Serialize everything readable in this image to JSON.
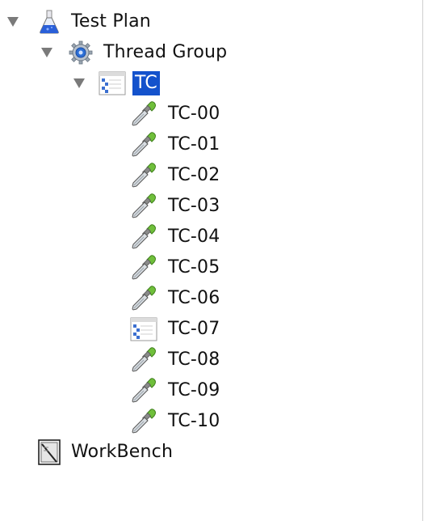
{
  "tree": {
    "test_plan": {
      "label": "Test Plan",
      "icon": "flask-icon",
      "expanded": true
    },
    "thread_group": {
      "label": "Thread Group",
      "icon": "gear-icon",
      "expanded": true
    },
    "controller": {
      "label": "TC",
      "icon": "module-controller-icon",
      "expanded": true,
      "selected": true
    },
    "children": [
      {
        "label": "TC-00",
        "icon": "sampler-pipette-icon"
      },
      {
        "label": "TC-01",
        "icon": "sampler-pipette-icon"
      },
      {
        "label": "TC-02",
        "icon": "sampler-pipette-icon"
      },
      {
        "label": "TC-03",
        "icon": "sampler-pipette-icon"
      },
      {
        "label": "TC-04",
        "icon": "sampler-pipette-icon"
      },
      {
        "label": "TC-05",
        "icon": "sampler-pipette-icon"
      },
      {
        "label": "TC-06",
        "icon": "sampler-pipette-icon"
      },
      {
        "label": "TC-07",
        "icon": "module-controller-icon"
      },
      {
        "label": "TC-08",
        "icon": "sampler-pipette-icon"
      },
      {
        "label": "TC-09",
        "icon": "sampler-pipette-icon"
      },
      {
        "label": "TC-10",
        "icon": "sampler-pipette-icon"
      }
    ],
    "workbench": {
      "label": "WorkBench",
      "icon": "workbench-icon"
    }
  },
  "colors": {
    "selection": "#1452cc",
    "toggle": "#7a7a7a",
    "text": "#111111"
  }
}
